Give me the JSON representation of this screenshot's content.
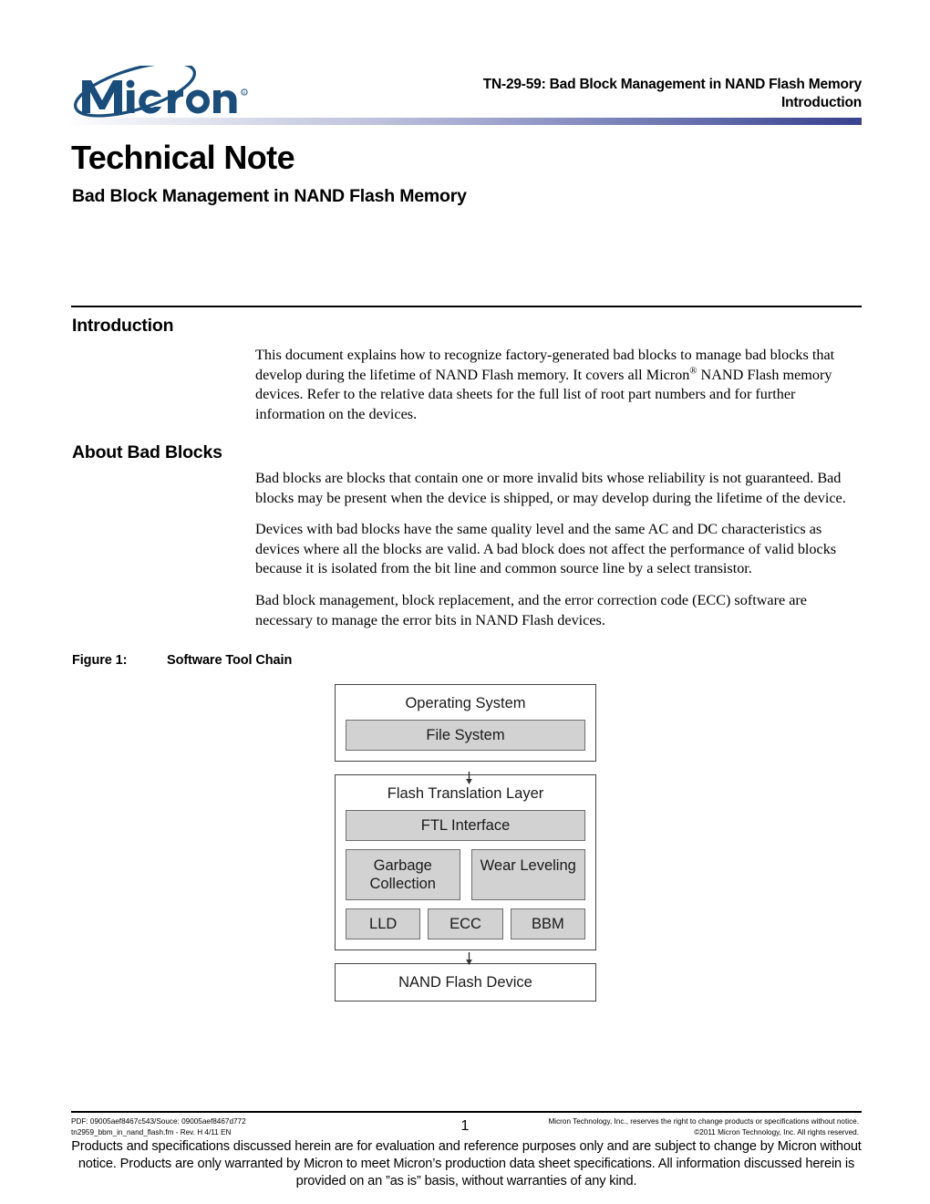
{
  "header": {
    "logo_text": "Micron",
    "logo_color": "#1a4d7a",
    "doc_id_line": "TN-29-59: Bad Block Management in NAND Flash Memory",
    "section_line": "Introduction",
    "rule_gradient_start": "#fefeff",
    "rule_gradient_end": "#3a448e"
  },
  "title": {
    "main": "Technical Note",
    "sub": "Bad Block Management in NAND Flash Memory"
  },
  "sections": [
    {
      "heading": "Introduction",
      "paragraphs": [
        "This document explains how to recognize factory-generated bad blocks to manage bad blocks that develop during the lifetime of NAND Flash memory. It covers all Micron® NAND Flash memory devices. Refer to the relative data sheets for the full list of root part numbers and for further information on the devices."
      ]
    },
    {
      "heading": "About Bad Blocks",
      "paragraphs": [
        "Bad blocks are blocks that contain one or more invalid bits whose reliability is not guaranteed. Bad blocks may be present when the device is shipped, or may develop during the lifetime of the device.",
        "Devices with bad blocks have the same quality level and the same AC and DC characteristics as devices where all the blocks are valid. A bad block does not affect the performance of valid blocks because it is isolated from the bit line and common source line by a select transistor.",
        "Bad block management, block replacement, and the error correction code (ECC) software are necessary to manage the error bits in NAND Flash devices."
      ]
    }
  ],
  "figure": {
    "label": "Figure 1:",
    "title": "Software Tool Chain",
    "diagram": {
      "os_box": {
        "title": "Operating System",
        "children": [
          "File System"
        ]
      },
      "ftl_box": {
        "title": "Flash Translation Layer",
        "interface": "FTL Interface",
        "row2": [
          "Garbage Collection",
          "Wear Leveling"
        ],
        "row3": [
          "LLD",
          "ECC",
          "BBM"
        ]
      },
      "device_box": {
        "title": "NAND Flash Device"
      },
      "box_fill": "#d2d2d2",
      "box_border": "#6f6f6f"
    }
  },
  "footer": {
    "left_line1": "PDF: 09005aef8467c543/Souce: 09005aef8467d772",
    "left_line2": "tn2959_bbm_in_nand_flash.fm - Rev. H 4/11 EN",
    "page_number": "1",
    "right_line1": "Micron Technology, Inc., reserves the right to change products or specifications without notice.",
    "right_line2": "©2011 Micron Technology, Inc. All rights reserved.",
    "disclaimer": "Products and specifications discussed herein are for evaluation and reference purposes only and are subject to change by Micron without notice. Products are only warranted by Micron to meet Micron’s production data sheet specifications. All information discussed herein is provided on an ”as is” basis, without warranties of any kind."
  }
}
